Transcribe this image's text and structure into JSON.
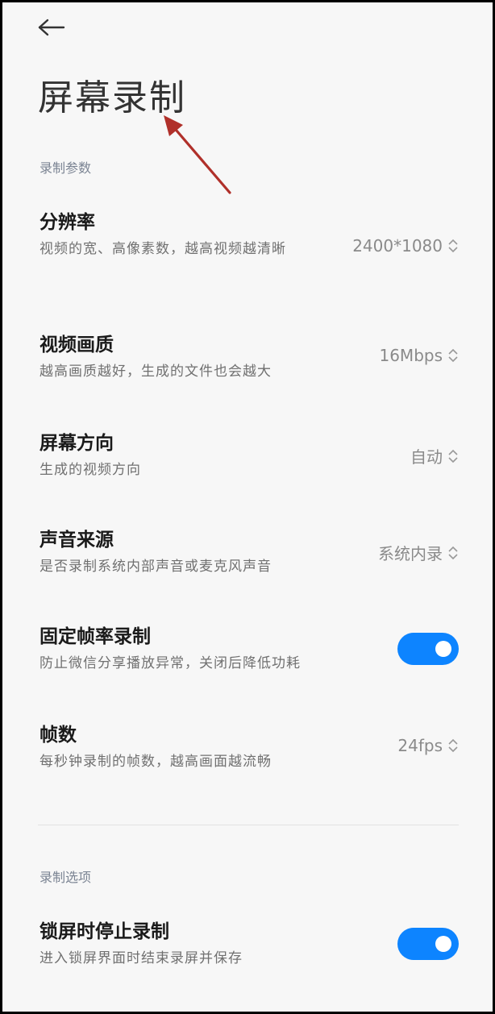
{
  "header": {
    "back_icon": "arrow-left-icon",
    "title": "屏幕录制"
  },
  "annotation": {
    "arrow_icon": "red-arrow-icon",
    "color": "#b0302a"
  },
  "sections": {
    "params": "录制参数",
    "options": "录制选项"
  },
  "settings": {
    "resolution": {
      "title": "分辨率",
      "desc": "视频的宽、高像素数，越高视频越清晰",
      "value": "2400*1080"
    },
    "quality": {
      "title": "视频画质",
      "desc": "越高画质越好，生成的文件也会越大",
      "value": "16Mbps"
    },
    "orientation": {
      "title": "屏幕方向",
      "desc": "生成的视频方向",
      "value": "自动"
    },
    "sound": {
      "title": "声音来源",
      "desc": "是否录制系统内部声音或麦克风声音",
      "value": "系统内录"
    },
    "fixed_fps": {
      "title": "固定帧率录制",
      "desc": "防止微信分享播放异常，关闭后降低功耗",
      "enabled": true
    },
    "fps": {
      "title": "帧数",
      "desc": "每秒钟录制的帧数，越高画面越流畅",
      "value": "24fps"
    },
    "lock_stop": {
      "title": "锁屏时停止录制",
      "desc": "进入锁屏界面时结束录屏并保存",
      "enabled": true
    }
  },
  "colors": {
    "accent": "#0d84ff",
    "background": "#f7f7f7",
    "title_text": "#1a1a1a",
    "secondary_text": "#707070"
  }
}
